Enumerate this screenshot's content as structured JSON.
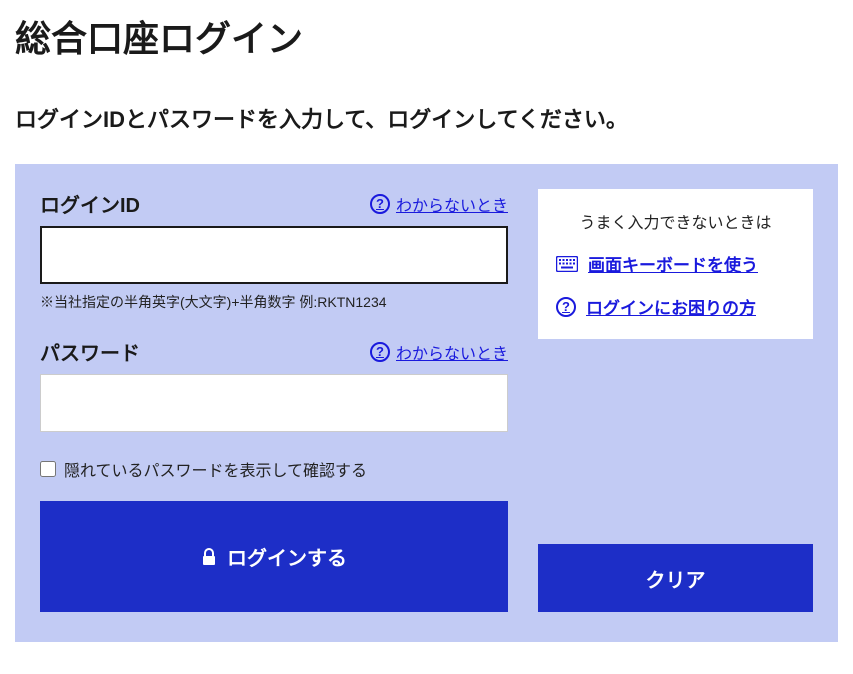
{
  "page": {
    "title": "総合口座ログイン",
    "subtitle": "ログインIDとパスワードを入力して、ログインしてください。"
  },
  "login_id": {
    "label": "ログインID",
    "help_link": "わからないとき",
    "value": "",
    "hint": "※当社指定の半角英字(大文字)+半角数字 例:RKTN1234"
  },
  "password": {
    "label": "パスワード",
    "help_link": "わからないとき",
    "value": "",
    "show_checkbox_label": "隠れているパスワードを表示して確認する"
  },
  "buttons": {
    "login": "ログインする",
    "clear": "クリア"
  },
  "help_box": {
    "title": "うまく入力できないときは",
    "screen_keyboard": "画面キーボードを使う",
    "trouble_login": "ログインにお困りの方"
  }
}
